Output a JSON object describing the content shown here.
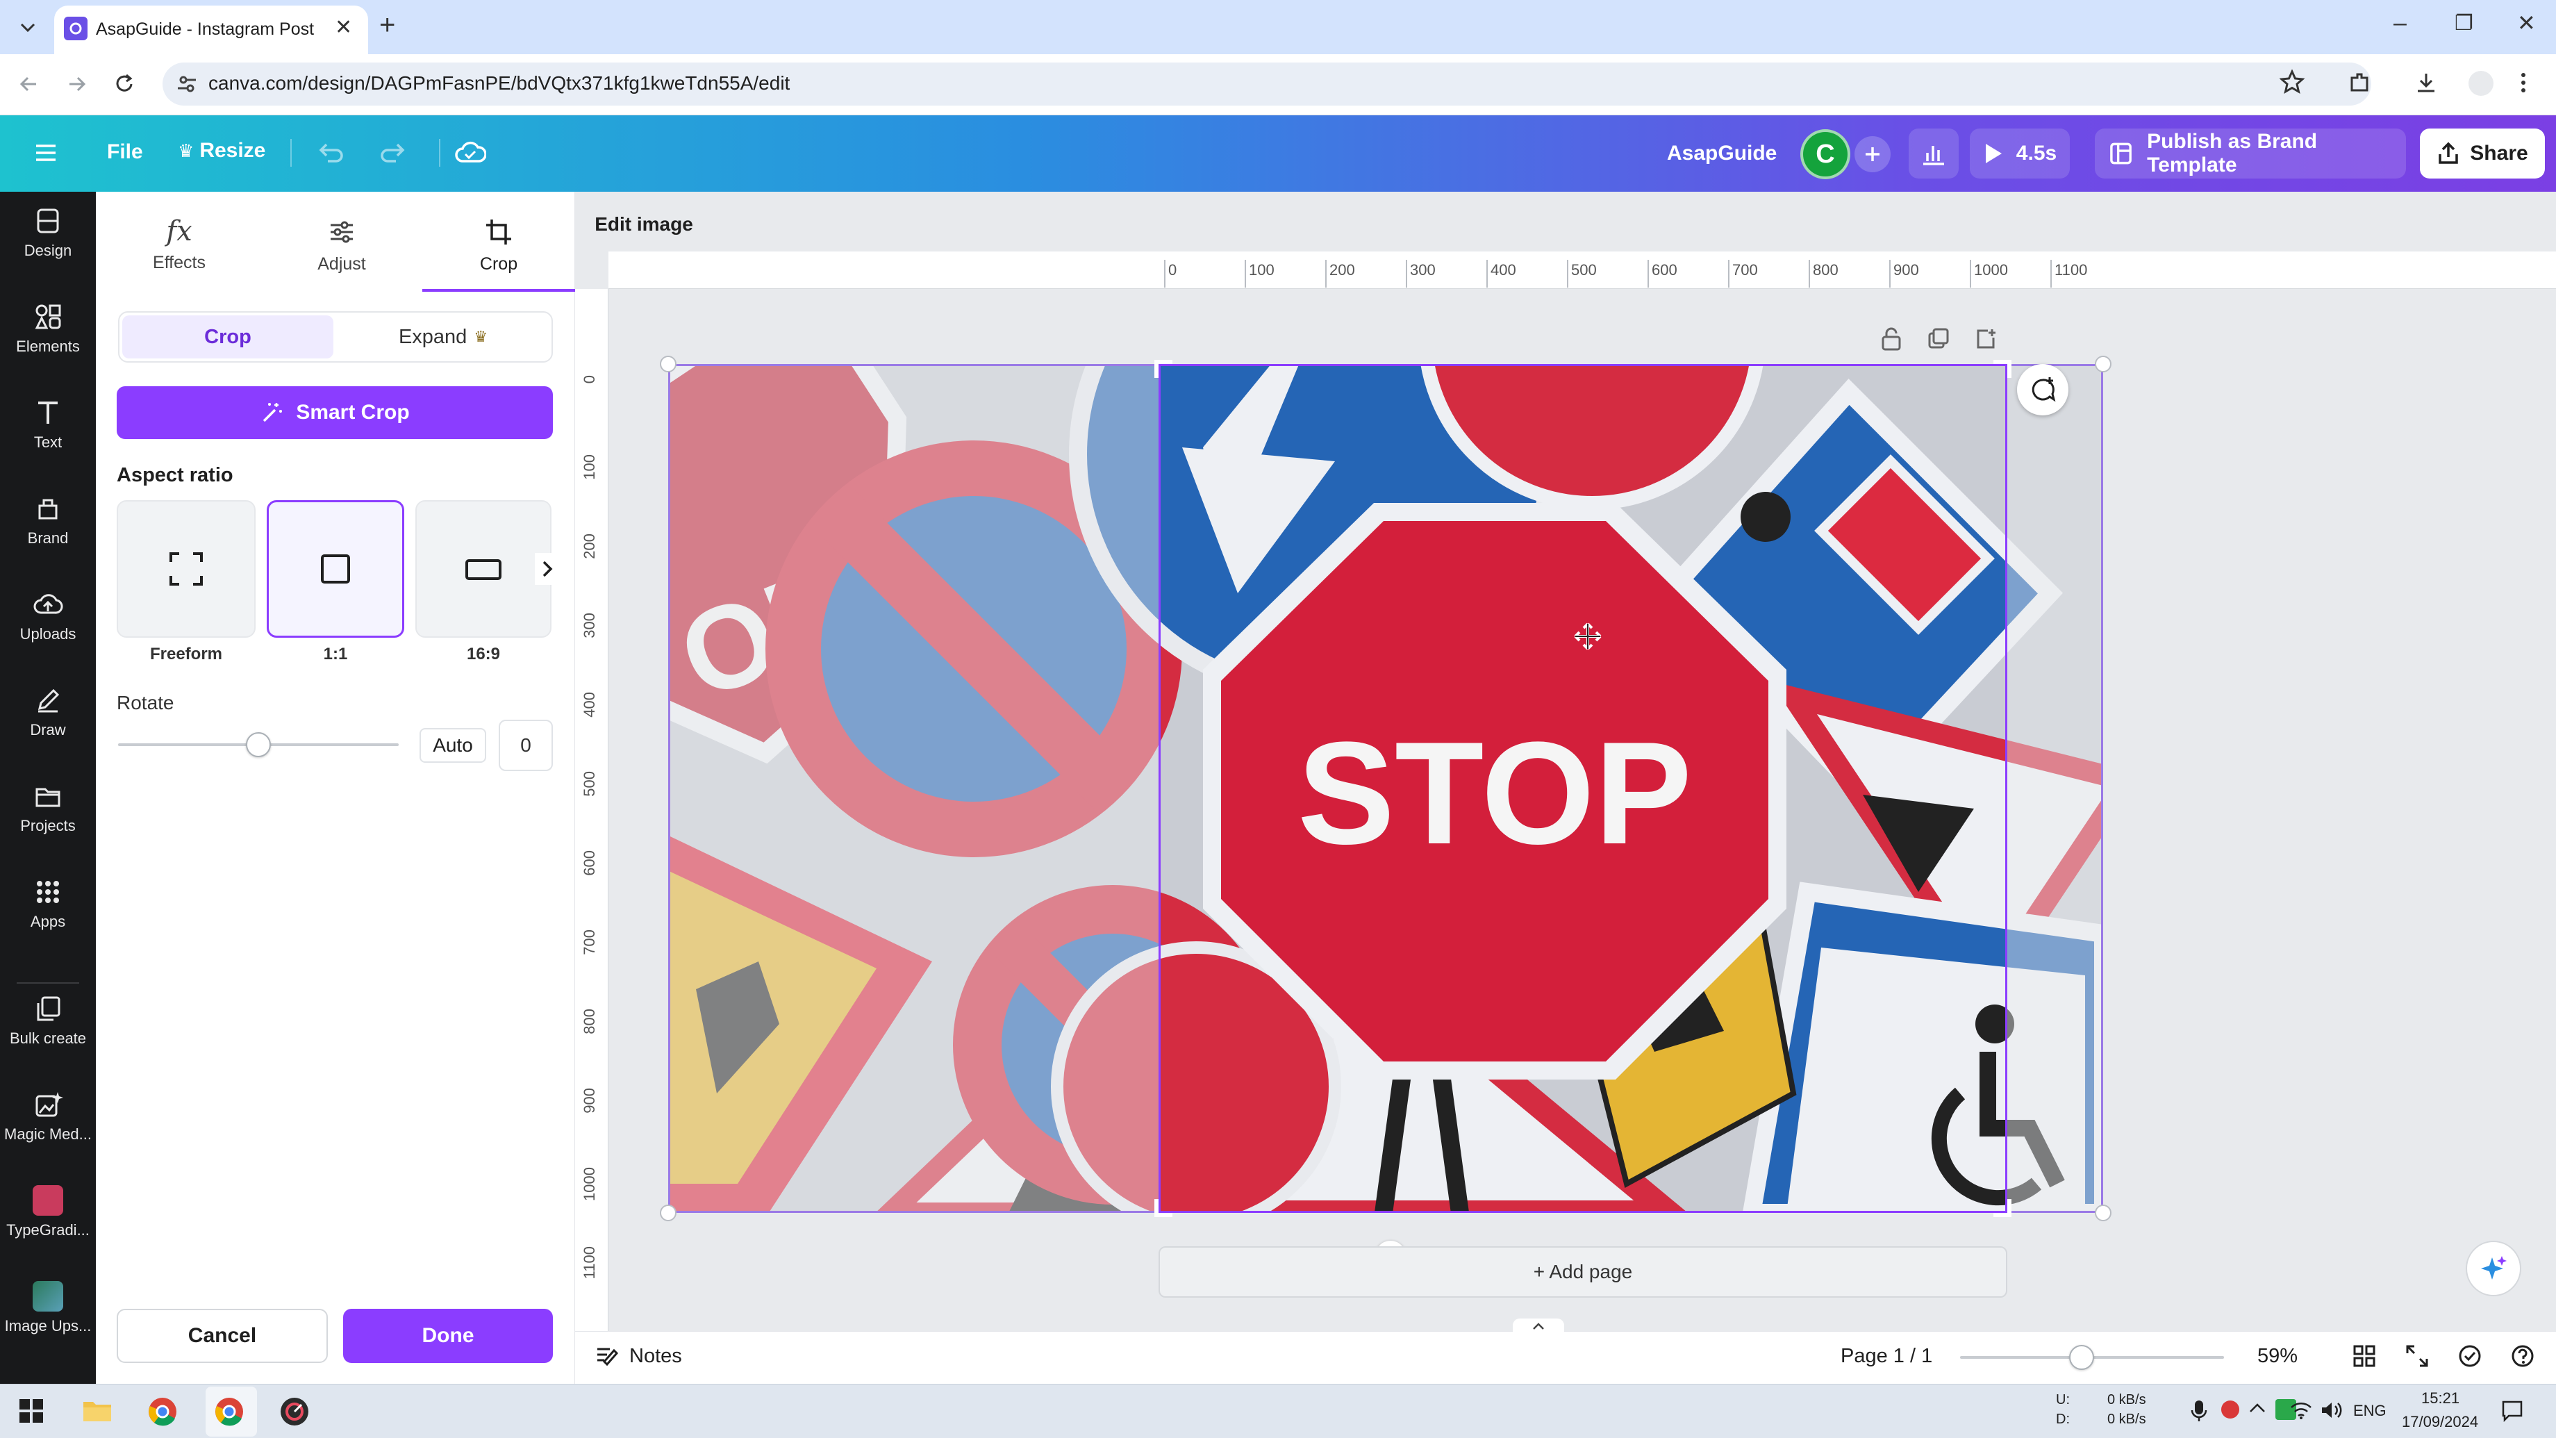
{
  "browser": {
    "tab_title": "AsapGuide - Instagram Post",
    "url": "canva.com/design/DAGPmFasnPE/bdVQtx371kfg1kweTdn55A/edit",
    "new_tab_symbol": "+",
    "win_min": "–",
    "win_max": "❐",
    "win_close": "✕"
  },
  "header": {
    "file": "File",
    "resize": "Resize",
    "brand_name": "AsapGuide",
    "avatar_initial": "C",
    "play_time": "4.5s",
    "publish": "Publish as Brand Template",
    "share": "Share"
  },
  "rail": {
    "items": [
      {
        "label": "Design",
        "icon": "design-icon"
      },
      {
        "label": "Elements",
        "icon": "elements-icon"
      },
      {
        "label": "Text",
        "icon": "text-icon"
      },
      {
        "label": "Brand",
        "icon": "brand-icon"
      },
      {
        "label": "Uploads",
        "icon": "uploads-icon"
      },
      {
        "label": "Draw",
        "icon": "draw-icon"
      },
      {
        "label": "Projects",
        "icon": "projects-icon"
      },
      {
        "label": "Apps",
        "icon": "apps-icon"
      },
      {
        "label": "Bulk create",
        "icon": "bulk-create-icon"
      },
      {
        "label": "Magic Med...",
        "icon": "magic-media-icon"
      },
      {
        "label": "TypeGradi...",
        "icon": "typegradient-icon"
      },
      {
        "label": "Image Ups...",
        "icon": "image-upscaler-icon"
      }
    ]
  },
  "panel": {
    "tabs": [
      {
        "label": "Effects",
        "icon": "fx-icon"
      },
      {
        "label": "Adjust",
        "icon": "sliders-icon"
      },
      {
        "label": "Crop",
        "icon": "crop-icon"
      }
    ],
    "seg_crop": "Crop",
    "seg_expand": "Expand",
    "smart_crop": "Smart Crop",
    "aspect_ratio": "Aspect ratio",
    "ratios": [
      {
        "label": "Freeform"
      },
      {
        "label": "1:1"
      },
      {
        "label": "16:9"
      }
    ],
    "rotate": "Rotate",
    "rotate_auto": "Auto",
    "rotate_value": "0",
    "rotate_level": 0.5,
    "cancel": "Cancel",
    "done": "Done"
  },
  "canvas": {
    "edit_image": "Edit image",
    "ruler_top": [
      "0",
      "100",
      "200",
      "300",
      "400",
      "500",
      "600",
      "700",
      "800",
      "900",
      "1000",
      "1100"
    ],
    "ruler_left": [
      "0",
      "100",
      "200",
      "300",
      "400",
      "500",
      "600",
      "700",
      "800",
      "900",
      "1000",
      "1100"
    ],
    "sign_text_main": "STOP",
    "sign_text_side": "OP",
    "add_page": "+ Add page"
  },
  "bottom": {
    "notes": "Notes",
    "page": "Page 1 / 1",
    "zoom": "59%",
    "zoom_level": 0.46
  },
  "taskbar": {
    "net_up_label": "U:",
    "net_down_label": "D:",
    "net_up": "0 kB/s",
    "net_down": "0 kB/s",
    "lang": "ENG",
    "time": "15:21",
    "date": "17/09/2024"
  },
  "colors": {
    "accent": "#8b3dff",
    "rail_bg": "#18191b",
    "header_from": "#1ec2cf",
    "header_to": "#7b3fe4"
  }
}
